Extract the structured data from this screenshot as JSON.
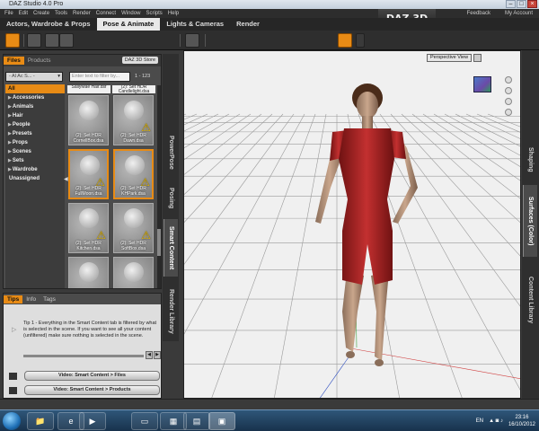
{
  "window": {
    "title": "DAZ Studio 4.0 Pro"
  },
  "menu": [
    "File",
    "Edit",
    "Create",
    "Tools",
    "Render",
    "Connect",
    "Window",
    "Scripts",
    "Help"
  ],
  "header_right": {
    "feedback": "Feedback",
    "my_account": "My Account",
    "logo": "DAZ 3D"
  },
  "room_tabs": [
    {
      "label": "Actors, Wardrobe & Props",
      "active": false
    },
    {
      "label": "Pose & Animate",
      "active": true
    },
    {
      "label": "Lights & Cameras",
      "active": false
    },
    {
      "label": "Render",
      "active": false
    }
  ],
  "content_panel": {
    "tabs": [
      {
        "label": "Files",
        "active": true
      },
      {
        "label": "Products",
        "active": false
      }
    ],
    "store_button": "DAZ 3D Store",
    "category_select": "- Al Ac S... -",
    "filter_placeholder": "Enter text to filter by...",
    "count": "1 - 123",
    "categories": [
      {
        "label": "All",
        "active": true,
        "arrow": ""
      },
      {
        "label": "Accessories",
        "active": false,
        "arrow": "▶"
      },
      {
        "label": "Animals",
        "active": false,
        "arrow": "▶"
      },
      {
        "label": "Hair",
        "active": false,
        "arrow": "▶"
      },
      {
        "label": "People",
        "active": false,
        "arrow": "▶"
      },
      {
        "label": "Presets",
        "active": false,
        "arrow": "▶"
      },
      {
        "label": "Props",
        "active": false,
        "arrow": "▶"
      },
      {
        "label": "Scenes",
        "active": false,
        "arrow": "▶"
      },
      {
        "label": "Sets",
        "active": false,
        "arrow": "▶"
      },
      {
        "label": "Wardrobe",
        "active": false,
        "arrow": "▶"
      },
      {
        "label": "Unassigned",
        "active": false,
        "arrow": ""
      }
    ],
    "top_items": [
      {
        "label": "SallyMae Hair.dsf"
      },
      {
        "label": "(2): Set HDR Candlelight.dsa"
      }
    ],
    "items": [
      {
        "label": "(2): Set HDR CornellBox.dsa",
        "selected": false,
        "warning": false
      },
      {
        "label": "(2): Set HDR Dawn.dsa",
        "selected": false,
        "warning": true
      },
      {
        "label": "(2): Set HDR FullMoon.dsa",
        "selected": true,
        "warning": true
      },
      {
        "label": "(2): Set HDR KHPark.dsa",
        "selected": true,
        "warning": true
      },
      {
        "label": "(2): Set HDR Kitchen.dsa",
        "selected": false,
        "warning": true
      },
      {
        "label": "(2): Set HDR SoftBox.dsa",
        "selected": false,
        "warning": true
      },
      {
        "label": "",
        "selected": false,
        "warning": false
      },
      {
        "label": "",
        "selected": false,
        "warning": false
      }
    ]
  },
  "side_tabs": [
    {
      "label": "PowerPose",
      "active": false
    },
    {
      "label": "Posing",
      "active": false
    },
    {
      "label": "Smart Content",
      "active": true
    },
    {
      "label": "Render Library",
      "active": false
    }
  ],
  "tips_panel": {
    "tabs": [
      {
        "label": "Tips",
        "active": true
      },
      {
        "label": "Info",
        "active": false
      },
      {
        "label": "Tags",
        "active": false
      }
    ],
    "tip_text": "Tip 1 - Everything in the Smart Content tab is filtered by what is selected in the scene. If you want to see all your content (unfiltered) make sure nothing is selected in the scene.",
    "videos": [
      "Video: Smart Content > Files",
      "Video: Smart Content > Products"
    ]
  },
  "viewport": {
    "camera_label": "Perspective View"
  },
  "right_tabs": [
    {
      "label": "Shaping",
      "active": false
    },
    {
      "label": "Surfaces (Color)",
      "active": true
    },
    {
      "label": "Content Library",
      "active": false
    }
  ],
  "taskbar": {
    "language": "EN",
    "time": "23:16",
    "date": "16/10/2012"
  },
  "colors": {
    "accent": "#e88b15",
    "panel": "#4b4b4b",
    "dark": "#2e2e2e",
    "viewport": "#f0f0f0",
    "figure": "#b52828"
  }
}
